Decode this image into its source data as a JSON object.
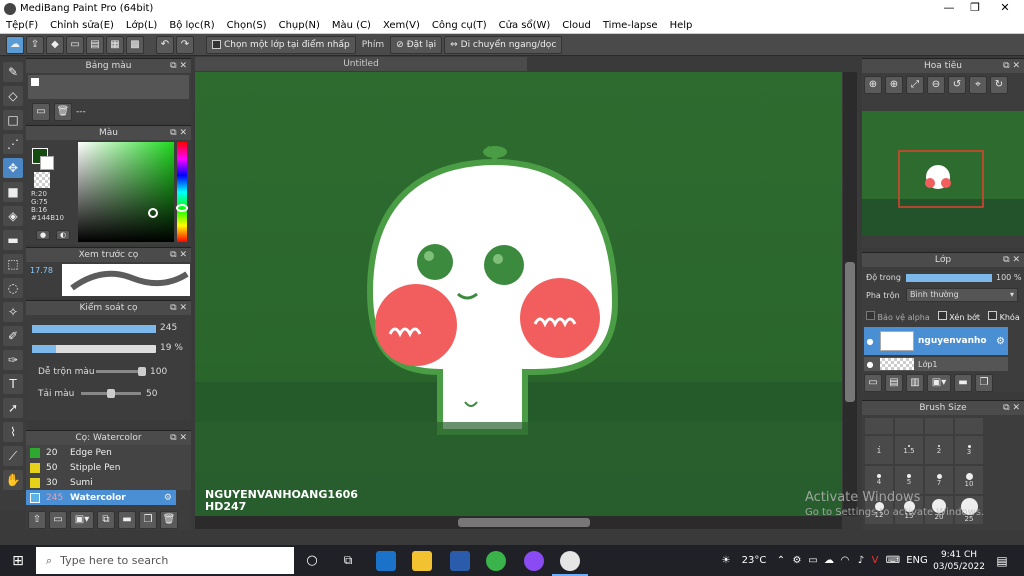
{
  "window": {
    "title": "MediBang Paint Pro (64bit)",
    "minimize": "—",
    "maximize": "❐",
    "close": "✕"
  },
  "menu": [
    "Tệp(F)",
    "Chỉnh sửa(E)",
    "Lớp(L)",
    "Bộ lọc(R)",
    "Chọn(S)",
    "Chụp(N)",
    "Màu (C)",
    "Xem(V)",
    "Công cụ(T)",
    "Cửa sổ(W)",
    "Cloud",
    "Time-lapse",
    "Help"
  ],
  "toolbar": {
    "select_layer_label": "Chọn một lớp tại điểm nhấp",
    "key_label": "Phím",
    "reset_label": "Đặt lại",
    "move_label": "Di chuyển ngang/dọc"
  },
  "canvas_tab": {
    "title": "Untitled"
  },
  "palette_panel": {
    "title": "Bảng màu",
    "dash": "---"
  },
  "color_panel": {
    "title": "Màu",
    "r": "R:20",
    "g": "G:75",
    "b": "B:16",
    "hex": "#144B10",
    "colors": {
      "current": "#144B10"
    }
  },
  "brush_preview_panel": {
    "title": "Xem trước cọ",
    "size": "17.78"
  },
  "brush_control_panel": {
    "title": "Kiểm soát cọ",
    "size_value": "245",
    "opacity_value": "19 %",
    "blend_label": "Dễ trộn màu",
    "blend_value": "100",
    "ink_label": "Tải màu",
    "ink_value": "50"
  },
  "brush_list_panel": {
    "title": "Cọ: Watercolor",
    "items": [
      {
        "size": "20",
        "name": "Edge Pen",
        "color": "#2fa82f"
      },
      {
        "size": "50",
        "name": "Stipple Pen",
        "color": "#e6d21a"
      },
      {
        "size": "30",
        "name": "Sumi",
        "color": "#e6d21a"
      },
      {
        "size": "245",
        "name": "Watercolor",
        "color": "#5ab3e6"
      }
    ]
  },
  "navigator_panel": {
    "title": "Hoa tiêu"
  },
  "layer_panel": {
    "title": "Lớp",
    "opacity_label": "Độ trong",
    "opacity_value": "100 %",
    "blend_label": "Pha trộn",
    "blend_value": "Bình thường",
    "protect_alpha": "Bảo vệ alpha",
    "clip": "Xén bớt",
    "lock": "Khóa",
    "layers": [
      {
        "name": "nguyenvanho"
      },
      {
        "name": "Lớp1"
      }
    ]
  },
  "brush_size_panel": {
    "title": "Brush Size",
    "sizes": [
      "1",
      "1.5",
      "2",
      "3",
      "4",
      "5",
      "7",
      "10",
      "12",
      "15",
      "20",
      "25"
    ]
  },
  "canvas": {
    "signature_line1": "NGUYENVANHOANG1606",
    "signature_line2": "HD247"
  },
  "watermark": {
    "line1": "Activate Windows",
    "line2": "Go to Settings to activate Windows."
  },
  "taskbar": {
    "search_placeholder": "Type here to search",
    "weather": "23°C",
    "lang": "ENG",
    "time": "9:41 CH",
    "date": "03/05/2022"
  }
}
